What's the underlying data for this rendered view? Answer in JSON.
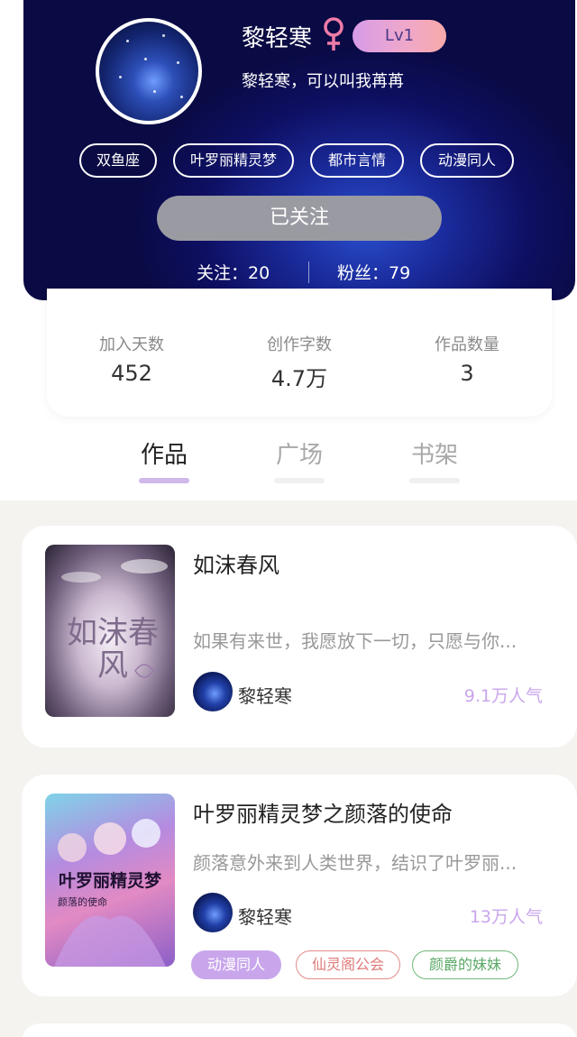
{
  "profile": {
    "name": "黎轻寒",
    "gender_icon": "female-icon",
    "level": "Lv1",
    "bio": "黎轻寒，可以叫我苒苒",
    "tags": [
      "双鱼座",
      "叶罗丽精灵梦",
      "都市言情",
      "动漫同人"
    ],
    "follow_button": "已关注",
    "following_label": "关注：20",
    "fans_label": "粉丝：79"
  },
  "stats": [
    {
      "label": "加入天数",
      "value": "452"
    },
    {
      "label": "创作字数",
      "value": "4.7万"
    },
    {
      "label": "作品数量",
      "value": "3"
    }
  ],
  "tabs": [
    {
      "label": "作品",
      "active": true
    },
    {
      "label": "广场",
      "active": false
    },
    {
      "label": "书架",
      "active": false
    }
  ],
  "books": [
    {
      "title": "如沫春风",
      "description": "如果有来世，我愿放下一切，只愿与你...",
      "author": "黎轻寒",
      "popularity": "9.1万人气",
      "cover_text": "如沫春风",
      "tags": []
    },
    {
      "title": "叶罗丽精灵梦之颜落的使命",
      "description": "颜落意外来到人类世界，结识了叶罗丽...",
      "author": "黎轻寒",
      "popularity": "13万人气",
      "cover_text": "叶罗丽精灵梦",
      "cover_subtext": "颜落的使命",
      "tags": [
        {
          "label": "动漫同人",
          "color": "#b892e0"
        },
        {
          "label": "仙灵阁公会",
          "color": "#e38a8a"
        },
        {
          "label": "颜爵的妹妹",
          "color": "#6fb87a"
        }
      ]
    }
  ],
  "colors": {
    "header_dark": "#0e0f62",
    "accent_purple": "#cfb8ea",
    "popularity": "#c9a6ec"
  }
}
